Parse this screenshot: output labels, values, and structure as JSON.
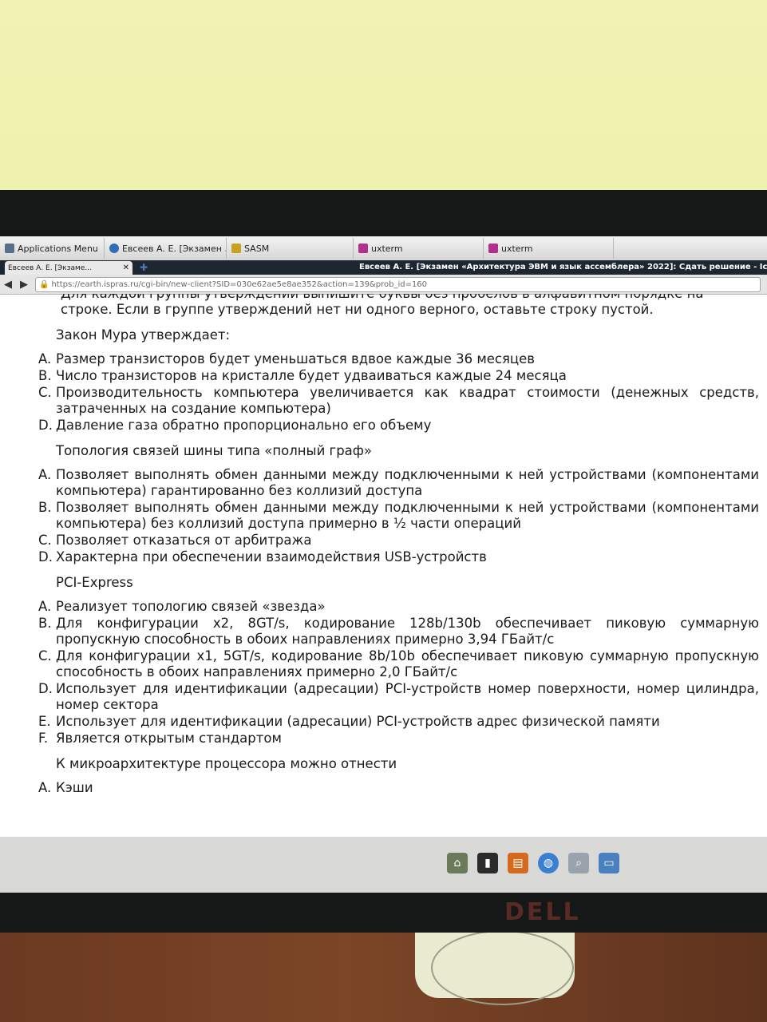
{
  "taskbar": {
    "items": [
      {
        "label": "Applications Menu"
      },
      {
        "label": "Евсеев А. Е. [Экзамен ..."
      },
      {
        "label": "SASM"
      },
      {
        "label": "uxterm"
      },
      {
        "label": "uxterm"
      }
    ]
  },
  "browser": {
    "window_title": "Евсеев А. Е. [Экзамен «Архитектура ЭВМ и язык ассемблера» 2022]: Сдать решение - Iceweasel",
    "tab_title": "Евсеев А. Е. [Экзаме...",
    "url": "https://earth.ispras.ru/cgi-bin/new-client?SID=030e62ae5e8ae352&action=139&prob_id=160"
  },
  "page": {
    "instruction_cut": "Для каждой группы утверждений выпишите буквы без пробелов в алфавитном порядке на отдельной",
    "instruction": "строке. Если в группе утверждений нет ни одного верного, оставьте строку пустой.",
    "questions": [
      {
        "title": "Закон Мура утверждает:",
        "options": [
          {
            "mark": "A.",
            "text": "Размер транзисторов будет уменьшаться вдвое каждые 36 месяцев"
          },
          {
            "mark": "B.",
            "text": "Число транзисторов на кристалле будет удваиваться каждые 24 месяца"
          },
          {
            "mark": "C.",
            "text": "Производительность компьютера увеличивается как квадрат стоимости (денежных средств, затраченных на создание компьютера)"
          },
          {
            "mark": "D.",
            "text": "Давление газа обратно пропорционально его объему"
          }
        ]
      },
      {
        "title": "Топология связей шины типа «полный граф»",
        "options": [
          {
            "mark": "A.",
            "text": "Позволяет выполнять обмен данными между подключенными к ней устройствами (компонентами компьютера) гарантированно без коллизий доступа"
          },
          {
            "mark": "B.",
            "text": "Позволяет выполнять обмен данными между подключенными к ней устройствами (компонентами компьютера) без коллизий доступа примерно в ½ части операций"
          },
          {
            "mark": "C.",
            "text": "Позволяет отказаться от арбитража"
          },
          {
            "mark": "D.",
            "text": "Характерна при обеспечении взаимодействия USB-устройств"
          }
        ]
      },
      {
        "title": "PCI-Express",
        "options": [
          {
            "mark": "A.",
            "text": "Реализует топологию связей «звезда»"
          },
          {
            "mark": "B.",
            "text": "Для конфигурации x2, 8GT/s, кодирование 128b/130b обеспечивает пиковую суммарную пропускную способность в обоих направлениях примерно 3,94 ГБайт/с"
          },
          {
            "mark": "C.",
            "text": "Для конфигурации x1, 5GT/s, кодирование 8b/10b обеспечивает пиковую суммарную пропускную способность в обоих направлениях примерно 2,0 ГБайт/с"
          },
          {
            "mark": "D.",
            "text": "Использует для идентификации (адресации) PCI-устройств номер поверхности, номер цилиндра, номер сектора"
          },
          {
            "mark": "E.",
            "text": "Использует для идентификации (адресации) PCI-устройств адрес физической памяти"
          },
          {
            "mark": "F.",
            "text": "Является открытым стандартом"
          }
        ]
      },
      {
        "title": "К микроархитектуре процессора можно отнести",
        "options": [
          {
            "mark": "A.",
            "text": "Кэши"
          }
        ]
      }
    ]
  },
  "monitor": {
    "brand": "DELL"
  },
  "dock": {
    "icons": [
      "home-icon",
      "terminal-icon",
      "files-icon",
      "browser-icon",
      "search-icon",
      "folder-icon"
    ]
  }
}
